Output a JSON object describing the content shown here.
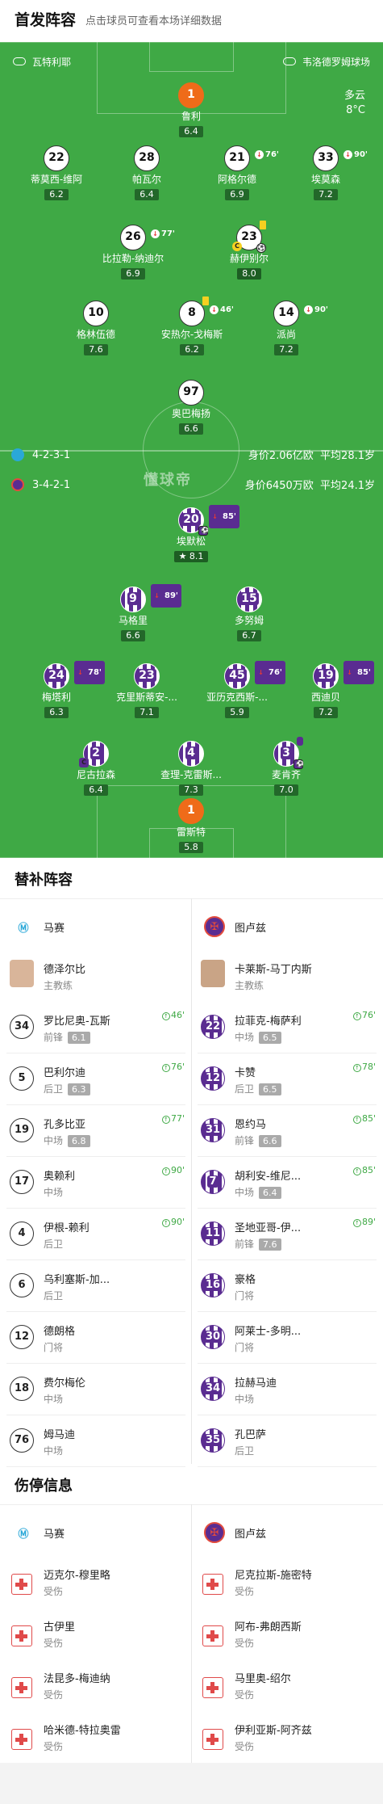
{
  "header": {
    "title": "首发阵容",
    "subtitle": "点击球员可查看本场详细数据"
  },
  "venue": {
    "referee": "瓦特利耶",
    "stadium": "韦洛德罗姆球场"
  },
  "weather": {
    "condition": "多云",
    "temp": "8°C"
  },
  "watermark": "懂球帝",
  "home_form": {
    "formation": "4-2-3-1",
    "value": "身价2.06亿欧",
    "age": "平均28.1岁"
  },
  "away_form": {
    "formation": "3-4-2-1",
    "value": "身价6450万欧",
    "age": "平均24.1岁"
  },
  "home_players": [
    {
      "num": "1",
      "name": "鲁利",
      "rating": "6.4"
    },
    {
      "num": "22",
      "name": "蒂莫西-维阿",
      "rating": "6.2"
    },
    {
      "num": "28",
      "name": "帕瓦尔",
      "rating": "6.4"
    },
    {
      "num": "21",
      "name": "阿格尔德",
      "rating": "6.9",
      "sub": "76'"
    },
    {
      "num": "33",
      "name": "埃莫森",
      "rating": "7.2",
      "sub": "90'"
    },
    {
      "num": "26",
      "name": "比拉勒-纳迪尔",
      "rating": "6.9",
      "sub": "77'"
    },
    {
      "num": "23",
      "name": "赫伊别尔",
      "rating": "8.0"
    },
    {
      "num": "10",
      "name": "格林伍德",
      "rating": "7.6"
    },
    {
      "num": "8",
      "name": "安热尔-戈梅斯",
      "rating": "6.2",
      "sub": "46'"
    },
    {
      "num": "14",
      "name": "派尚",
      "rating": "7.2",
      "sub": "90'"
    },
    {
      "num": "97",
      "name": "奥巴梅扬",
      "rating": "6.6"
    }
  ],
  "away_players": [
    {
      "num": "20",
      "name": "埃默松",
      "rating": "8.1",
      "sub": "85'"
    },
    {
      "num": "9",
      "name": "马格里",
      "rating": "6.6",
      "sub": "89'"
    },
    {
      "num": "15",
      "name": "多努姆",
      "rating": "6.7"
    },
    {
      "num": "24",
      "name": "梅塔利",
      "rating": "6.3",
      "sub": "78'"
    },
    {
      "num": "23",
      "name": "克里斯蒂安-...",
      "rating": "7.1"
    },
    {
      "num": "45",
      "name": "亚历克西斯-...",
      "rating": "5.9",
      "sub": "76'"
    },
    {
      "num": "19",
      "name": "西迪贝",
      "rating": "7.2",
      "sub": "85'"
    },
    {
      "num": "2",
      "name": "尼古拉森",
      "rating": "6.4"
    },
    {
      "num": "4",
      "name": "查理-克雷斯...",
      "rating": "7.3"
    },
    {
      "num": "3",
      "name": "麦肯齐",
      "rating": "7.0"
    },
    {
      "num": "1",
      "name": "雷斯特",
      "rating": "5.8"
    }
  ],
  "subs": {
    "title": "替补阵容",
    "home_team": "马赛",
    "away_team": "图卢兹",
    "home_coach": {
      "name": "德泽尔比",
      "role": "主教练"
    },
    "away_coach": {
      "name": "卡莱斯-马丁内斯",
      "role": "主教练"
    },
    "home": [
      {
        "num": "34",
        "name": "罗比尼奥-瓦斯",
        "pos": "前锋",
        "rating": "6.1",
        "time": "46'"
      },
      {
        "num": "5",
        "name": "巴利尔迪",
        "pos": "后卫",
        "rating": "6.3",
        "time": "76'"
      },
      {
        "num": "19",
        "name": "孔多比亚",
        "pos": "中场",
        "rating": "6.8",
        "time": "77'"
      },
      {
        "num": "17",
        "name": "奥赖利",
        "pos": "中场",
        "rating": "",
        "time": "90'"
      },
      {
        "num": "4",
        "name": "伊根-赖利",
        "pos": "后卫",
        "rating": "",
        "time": "90'"
      },
      {
        "num": "6",
        "name": "乌利塞斯-加...",
        "pos": "后卫",
        "rating": "",
        "time": ""
      },
      {
        "num": "12",
        "name": "德朗格",
        "pos": "门将",
        "rating": "",
        "time": ""
      },
      {
        "num": "18",
        "name": "费尔梅伦",
        "pos": "中场",
        "rating": "",
        "time": ""
      },
      {
        "num": "76",
        "name": "姆马迪",
        "pos": "中场",
        "rating": "",
        "time": ""
      }
    ],
    "away": [
      {
        "num": "22",
        "name": "拉菲克-梅萨利",
        "pos": "中场",
        "rating": "6.5",
        "time": "76'"
      },
      {
        "num": "12",
        "name": "卡赞",
        "pos": "后卫",
        "rating": "6.5",
        "time": "78'"
      },
      {
        "num": "31",
        "name": "恩约马",
        "pos": "前锋",
        "rating": "6.6",
        "time": "85'"
      },
      {
        "num": "7",
        "name": "胡利安-维尼...",
        "pos": "中场",
        "rating": "6.4",
        "time": "85'"
      },
      {
        "num": "11",
        "name": "圣地亚哥-伊...",
        "pos": "前锋",
        "rating": "7.6",
        "time": "89'"
      },
      {
        "num": "16",
        "name": "豪格",
        "pos": "门将",
        "rating": "",
        "time": ""
      },
      {
        "num": "30",
        "name": "阿莱士-多明...",
        "pos": "门将",
        "rating": "",
        "time": ""
      },
      {
        "num": "34",
        "name": "拉赫马迪",
        "pos": "中场",
        "rating": "",
        "time": ""
      },
      {
        "num": "35",
        "name": "孔巴萨",
        "pos": "后卫",
        "rating": "",
        "time": ""
      }
    ]
  },
  "injuries": {
    "title": "伤停信息",
    "home_team": "马赛",
    "away_team": "图卢兹",
    "home": [
      {
        "name": "迈克尔-穆里略",
        "status": "受伤"
      },
      {
        "name": "古伊里",
        "status": "受伤"
      },
      {
        "name": "法昆多-梅迪纳",
        "status": "受伤"
      },
      {
        "name": "哈米德-特拉奥雷",
        "status": "受伤"
      }
    ],
    "away": [
      {
        "name": "尼克拉斯-施密特",
        "status": "受伤"
      },
      {
        "name": "阿布-弗朗西斯",
        "status": "受伤"
      },
      {
        "name": "马里奥-绍尔",
        "status": "受伤"
      },
      {
        "name": "伊利亚斯-阿齐兹",
        "status": "受伤"
      }
    ]
  },
  "colors": {
    "pitch": "#3fa945",
    "home_gk": "#ef6b19",
    "toulouse": "#5a2c91",
    "sub_green": "#3fa945"
  }
}
